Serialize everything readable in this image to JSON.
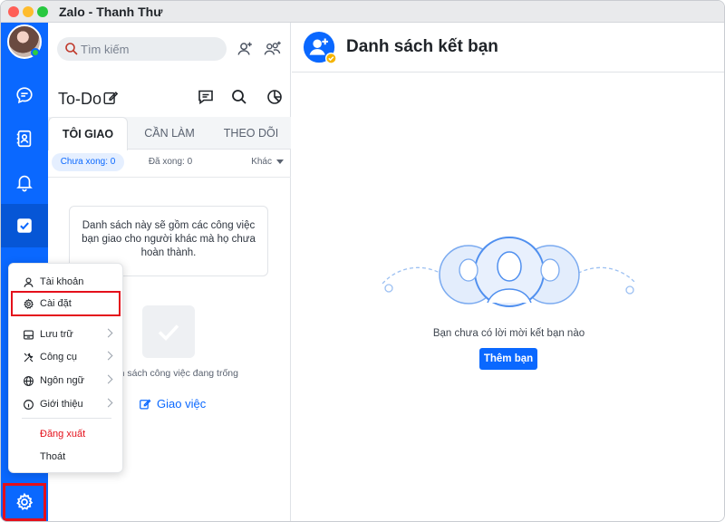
{
  "window": {
    "title": "Zalo - Thanh Thư"
  },
  "rail": {
    "items": [
      {
        "name": "messages",
        "icon": "chat-bubble-icon"
      },
      {
        "name": "contacts",
        "icon": "contact-card-icon"
      },
      {
        "name": "notifications",
        "icon": "bell-icon"
      },
      {
        "name": "todo",
        "icon": "checkbox-icon",
        "active": true
      }
    ],
    "settings_icon": "gear-icon"
  },
  "search": {
    "placeholder": "Tìm kiếm"
  },
  "todo": {
    "title": "To-Do",
    "tabs": [
      {
        "label": "TÔI GIAO",
        "active": true
      },
      {
        "label": "CẦN LÀM"
      },
      {
        "label": "THEO DÕI"
      }
    ],
    "filters": {
      "incomplete": "Chưa xong: 0",
      "done": "Đã xong: 0",
      "other": "Khác"
    },
    "info_text": "Danh sách này sẽ gồm các công việc bạn giao cho người khác mà họ chưa hoàn thành.",
    "empty_text": "nh sách công việc đang trống",
    "assign_label": "Giao việc"
  },
  "menu": {
    "account": "Tài khoản",
    "settings": "Cài đặt",
    "storage": "Lưu trữ",
    "tools": "Công cụ",
    "language": "Ngôn ngữ",
    "about": "Giới thiệu",
    "logout": "Đăng xuất",
    "quit": "Thoát"
  },
  "friends": {
    "title": "Danh sách kết bạn",
    "empty_message": "Bạn chưa có lời mời kết bạn nào",
    "add_button": "Thêm bạn"
  },
  "colors": {
    "brand": "#0a68ff",
    "highlight": "#e4101b"
  }
}
